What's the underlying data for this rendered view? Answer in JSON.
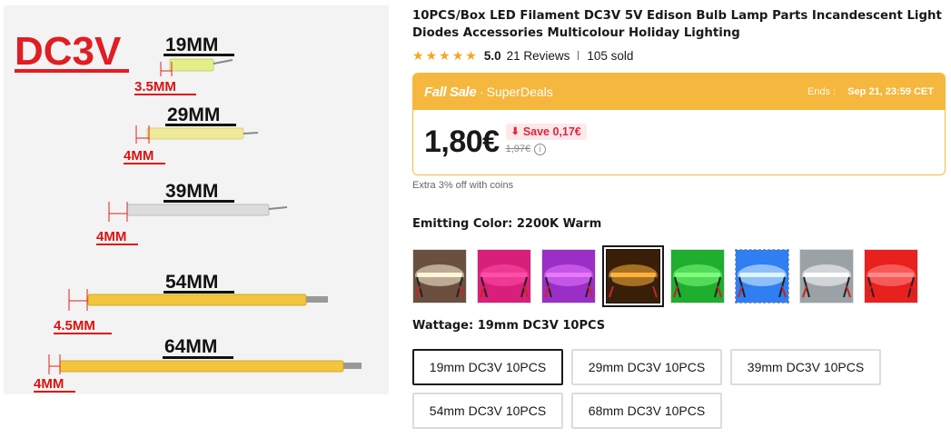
{
  "product_image": {
    "voltage": "DC3V",
    "filaments": [
      {
        "length": "19MM",
        "lead": "3.5MM",
        "color": "#e3f08a"
      },
      {
        "length": "29MM",
        "lead": "4MM",
        "color": "#eeea9a"
      },
      {
        "length": "39MM",
        "lead": "4MM",
        "color": "#dcdcdc"
      },
      {
        "length": "54MM",
        "lead": "4.5MM",
        "color": "#f2c53c"
      },
      {
        "length": "64MM",
        "lead": "4MM",
        "color": "#f2c53c"
      }
    ]
  },
  "product": {
    "title": "10PCS/Box LED Filament DC3V 5V Edison Bulb Lamp Parts Incandescent Light Diodes Accessories Multicolour Holiday Lighting",
    "rating": "5.0",
    "reviews": "21 Reviews",
    "sold": "105 sold",
    "star_count": 5
  },
  "deal": {
    "brand": "Fall Sale",
    "separator": "·",
    "program": "SuperDeals",
    "ends_label": "Ends :",
    "ends_date": "Sep 21, 23:59 CET",
    "price": "1,80€",
    "save_label": "Save 0,17€",
    "old_price": "1,97€",
    "info_symbol": "i",
    "coins_note": "Extra 3% off with coins"
  },
  "color_option": {
    "label": "Emitting Color:",
    "value": "2200K Warm",
    "swatches": [
      {
        "name": "white",
        "glow": "#fff4d8",
        "bg": "#6b5040"
      },
      {
        "name": "pink",
        "glow": "#ff4fa8",
        "bg": "#d8207a"
      },
      {
        "name": "purple",
        "glow": "#e878ff",
        "bg": "#9b2ec6"
      },
      {
        "name": "warm-2200k",
        "glow": "#ffb23a",
        "bg": "#3a1f08"
      },
      {
        "name": "green",
        "glow": "#7dff7d",
        "bg": "#1fae2e"
      },
      {
        "name": "blue",
        "glow": "#dff4ff",
        "bg": "#2f7ef2"
      },
      {
        "name": "cool-white",
        "glow": "#ffffff",
        "bg": "#9aa2a6"
      },
      {
        "name": "red",
        "glow": "#ff8a8a",
        "bg": "#e8201e"
      }
    ],
    "selected_index": 3
  },
  "wattage_option": {
    "label": "Wattage:",
    "value": "19mm DC3V 10PCS",
    "options": [
      "19mm DC3V 10PCS",
      "29mm DC3V 10PCS",
      "39mm DC3V 10PCS",
      "54mm DC3V 10PCS",
      "68mm DC3V 10PCS"
    ],
    "selected_index": 0
  }
}
